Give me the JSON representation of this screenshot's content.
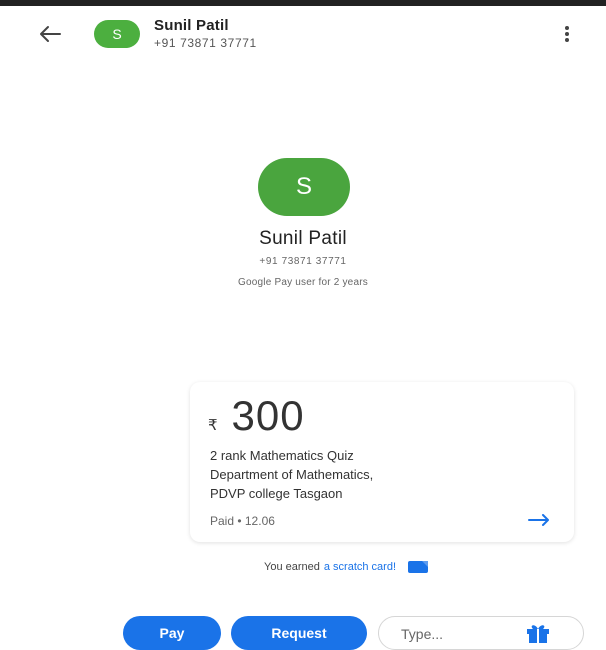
{
  "header": {
    "avatar_letter": "S",
    "contact_name": "Sunil Patil",
    "contact_phone": "+91 73871 37771",
    "back_icon": "arrow-back-icon",
    "menu_icon": "more-vert-icon"
  },
  "profile": {
    "avatar_letter": "S",
    "name": "Sunil Patil",
    "phone": "+91 73871 37771",
    "subtitle": "Google Pay user for 2 years"
  },
  "payment_card": {
    "currency_symbol": "₹",
    "amount": "300",
    "memo_lines": [
      "2 rank Mathematics Quiz",
      "Department of Mathematics,",
      "PDVP college Tasgaon"
    ],
    "status": "Paid • 12.06",
    "arrow_icon": "arrow-forward-icon"
  },
  "scratch": {
    "prefix": "You earned",
    "link": "a scratch card!",
    "icon": "scratch-card-icon"
  },
  "bottom_bar": {
    "pay_label": "Pay",
    "request_label": "Request",
    "message_placeholder": "Type...",
    "gift_icon": "gift-icon"
  },
  "colors": {
    "accent_blue": "#1a73e8",
    "avatar_green": "#4aa53e"
  }
}
